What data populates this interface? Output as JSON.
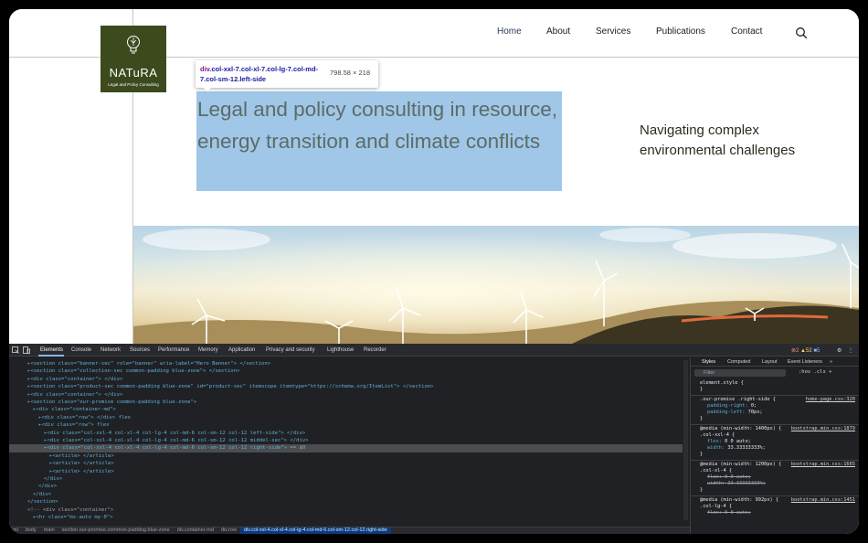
{
  "site": {
    "logo": {
      "name": "NATuRA",
      "tagline": "Legal and Policy Consulting"
    },
    "nav": [
      "Home",
      "About",
      "Services",
      "Publications",
      "Contact"
    ],
    "active_nav": "Home",
    "hero_title": "Legal and policy consulting in resource, energy transition and climate conflicts",
    "hero_side": "Navigating complex environmental challenges",
    "colors": {
      "logo_bg": "#3d4a1e",
      "highlight": "#6fa8dc"
    }
  },
  "inspector_tooltip": {
    "selector_tag": "div",
    "selector_classes": ".col-xxl-7.col-xl-7.col-lg-7.col-md-7.col-sm-12.left-side",
    "dimensions": "798.58 × 218"
  },
  "devtools": {
    "tabs": [
      "Elements",
      "Console",
      "Network",
      "Sources",
      "Performance",
      "Memory",
      "Application",
      "Privacy and security",
      "Lighthouse",
      "Recorder"
    ],
    "active_tab": "Elements",
    "badges": {
      "errors": "2",
      "warnings": "52",
      "info": "5"
    },
    "dom_lines": [
      {
        "indent": 1,
        "html": "<section class=\"banner-sec\" role=\"banner\" aria-label=\"Hero Banner\">",
        "tail": "</section>"
      },
      {
        "indent": 1,
        "html": "<section class=\"collection-sec common-padding blue-zone\">",
        "tail": "</section>"
      },
      {
        "indent": 1,
        "html": "<div class=\"container\">",
        "tail": "</div>"
      },
      {
        "indent": 1,
        "html": "<section class=\"product-sec common-padding blue-zone\" id=\"product-sec\" itemscope itemtype=\"https://schema.org/ItemList\">",
        "tail": "</section>"
      },
      {
        "indent": 1,
        "html": "<div class=\"container\">",
        "tail": "</div>"
      },
      {
        "indent": 1,
        "html": "<section class=\"our-promise common-padding blue-zone\">",
        "tail": ""
      },
      {
        "indent": 2,
        "html": "<div class=\"container-md\">",
        "tail": ""
      },
      {
        "indent": 3,
        "html": "<div class=\"row\">",
        "tail": "</div>  flex"
      },
      {
        "indent": 3,
        "html": "<div class=\"row\">",
        "tail": "flex"
      },
      {
        "indent": 4,
        "html": "<div class=\"col-xxl-4 col-xl-4 col-lg-4 col-md-6 col-sm-12 col-12 left-side\">",
        "tail": "</div>"
      },
      {
        "indent": 4,
        "html": "<div class=\"col-xxl-4 col-xl-4 col-lg-4 col-md-6 col-sm-12 col-12 middel-sec\">",
        "tail": "</div>"
      },
      {
        "indent": 4,
        "html": "<div class=\"col-xxl-4 col-xl-4 col-lg-4 col-md-6 col-sm-12 col-12 right-side\">",
        "tail": "== $0"
      },
      {
        "indent": 5,
        "html": "<article>",
        "tail": "</article>"
      },
      {
        "indent": 5,
        "html": "<article>",
        "tail": "</article>"
      },
      {
        "indent": 5,
        "html": "<article>",
        "tail": "</article>"
      },
      {
        "indent": 4,
        "html": "</div>",
        "tail": ""
      },
      {
        "indent": 3,
        "html": "</div>",
        "tail": ""
      },
      {
        "indent": 2,
        "html": "</div>",
        "tail": ""
      },
      {
        "indent": 1,
        "html": "</section>",
        "tail": ""
      },
      {
        "indent": 1,
        "html": "<!-- <div class=\"container\">",
        "tail": ""
      },
      {
        "indent": 2,
        "html": "<hr class=\"mx-auto my-0\">",
        "tail": ""
      }
    ],
    "selected_line": 11,
    "breadcrumbs": [
      "ml",
      "body",
      "main",
      "section.our-promise.common-padding.blue-zone",
      "div.container-md",
      "div.row",
      "div.col-xxl-4.col-xl-4.col-lg-4.col-md-6.col-sm-12.col-12.right-side"
    ],
    "styles_tabs": [
      "Styles",
      "Computed",
      "Layout",
      "Event Listeners"
    ],
    "styles_active": "Styles",
    "filter_placeholder": "Filter",
    "filter_tools": ":hov  .cls  +",
    "style_rules": [
      {
        "lines": [
          "element.style {",
          "}"
        ],
        "src": ""
      },
      {
        "lines": [
          ".our-promise .right-side {",
          "  padding-right: 0;",
          "  padding-left: 70px;",
          "}"
        ],
        "src": "home-page.css:320"
      },
      {
        "lines": [
          "@media (min-width: 1400px) {",
          ".col-xxl-4 {",
          "  flex: 0 0 auto;",
          "  width: 33.33333333%;",
          "}"
        ],
        "src": "bootstrap.min.css:1879"
      },
      {
        "lines": [
          "@media (min-width: 1200px) {",
          ".col-xl-4 {",
          "  flex: 0 0 auto;",
          "  width: 33.33333333%;",
          "}"
        ],
        "src": "bootstrap.min.css:1665"
      },
      {
        "lines": [
          "@media (min-width: 992px) {",
          ".col-lg-4 {",
          "  flex: 0 0 auto;"
        ],
        "src": "bootstrap.min.css:1451"
      }
    ]
  }
}
